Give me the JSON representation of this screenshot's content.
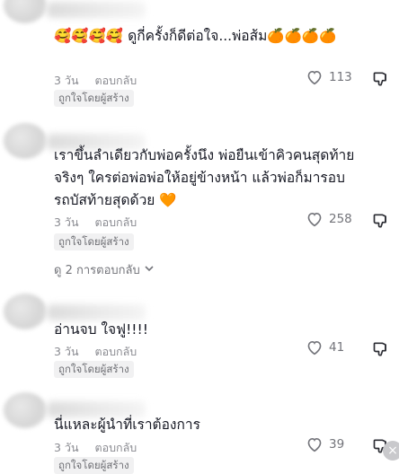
{
  "comments": [
    {
      "text": "🥰🥰🥰🥰 ดูกี่ครั้งก็ดีต่อใจ...พ่อส้ม🍊🍊🍊🍊",
      "time": "3 วัน",
      "reply_label": "ตอบกลับ",
      "likes": "113",
      "badge": "ถูกใจโดยผู้สร้าง"
    },
    {
      "text": "เราขึ้นลำเดียวกับพ่อครั้งนึง พ่อยืนเข้าคิวคนสุดท้ายจริงๆ ใครต่อพ่อพ่อให้อยู่ข้างหน้า แล้วพ่อก็มารอบรถบัสท้ายสุดด้วย 🧡",
      "time": "3 วัน",
      "reply_label": "ตอบกลับ",
      "likes": "258",
      "badge": "ถูกใจโดยผู้สร้าง",
      "view_replies": "ดู 2 การตอบกลับ"
    },
    {
      "text": "อ่านจบ ใจฟู!!!!",
      "time": "3 วัน",
      "reply_label": "ตอบกลับ",
      "likes": "41",
      "badge": "ถูกใจโดยผู้สร้าง"
    },
    {
      "text": "นี่แหละผู้นำที่เราต้องการ",
      "time": "3 วัน",
      "reply_label": "ตอบกลับ",
      "likes": "39",
      "badge": "ถูกใจโดยผู้สร้าง"
    }
  ],
  "icons": {
    "like": "heart-outline-icon",
    "dislike": "thumbs-down-icon",
    "expand": "chevron-down-icon"
  },
  "colors": {
    "meta": "#8a8b91",
    "badge_bg": "#f1f1f2"
  }
}
